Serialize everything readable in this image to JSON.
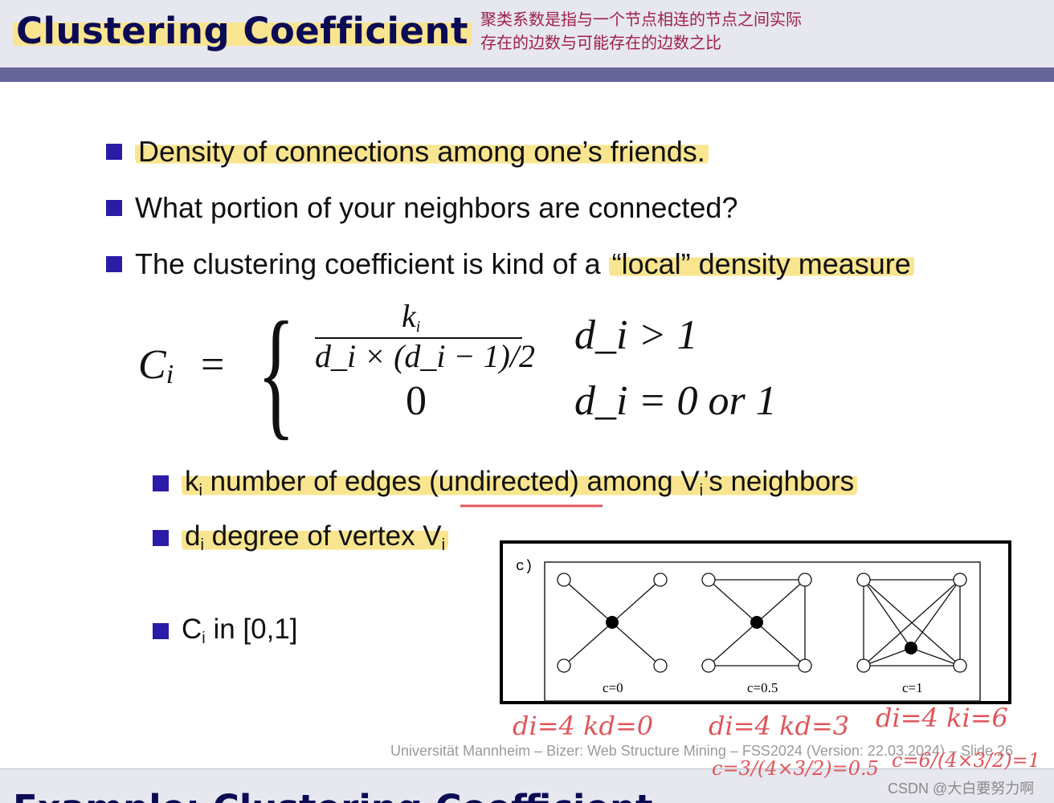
{
  "header": {
    "title": "Clustering Coefficient",
    "note": "聚类系数是指与一个节点相连的节点之间实际存在的边数与可能存在的边数之比"
  },
  "bullets": [
    {
      "text": "Density of connections among one’s friends."
    },
    {
      "text": "What portion of your neighbors are connected?"
    },
    {
      "text_before": "The clustering coefficient is kind of a ",
      "text_highlight": "“local” density measure"
    }
  ],
  "formula": {
    "lhs": "C",
    "lhs_sub": "i",
    "num": "k",
    "num_sub": "i",
    "den": "d_i × (d_i − 1)/2",
    "zero": "0",
    "cond1": "d_i > 1",
    "cond2": "d_i = 0 or 1"
  },
  "sub_bullets": [
    {
      "k": "k",
      "sub": "i",
      "text": " number of edges (undirected) among V",
      "sub2": "i",
      "tail": "’s neighbors"
    },
    {
      "k": "d",
      "sub": "i",
      "text": " degree of vertex V",
      "sub2": "i"
    },
    {
      "k": "C",
      "sub": "i",
      "text": " in [0,1]"
    }
  ],
  "diagram": {
    "label": "c)",
    "captions": [
      "c=0",
      "c=0.5",
      "c=1"
    ]
  },
  "annotations": [
    "di=4  kd=0",
    "di=4 kd=3",
    "di=4  ki=6",
    "c=3/(4×3/2)=0.5",
    "c=6/(4×3/2)=1"
  ],
  "footer": "Universität Mannheim – Bizer: Web Structure Mining – FSS2024 (Version: 22.03.2024) – Slide 26",
  "next_slide_title": "Example: Clustering Coefficient",
  "watermark": "CSDN @大白要努力啊",
  "colors": {
    "title": "#0b0b55",
    "bullet": "#2b1ba6",
    "highlight": "#f9e58f",
    "band": "#676699",
    "annotation": "#e0555a",
    "note": "#a0204a"
  }
}
